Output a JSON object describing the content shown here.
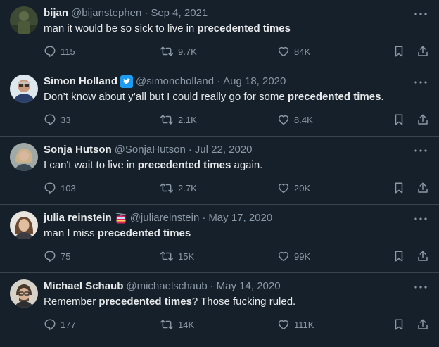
{
  "tweets": [
    {
      "name": "bijan",
      "handle": "@bijanstephen",
      "date": "Sep 4, 2021",
      "text_parts": [
        "man it would be so sick to live in ",
        "precedented times",
        ""
      ],
      "replies": "115",
      "retweets": "9.7K",
      "likes": "84K",
      "avatar_icon": "soldier-avatar"
    },
    {
      "name": "Simon Holland",
      "handle": "@simoncholland",
      "date": "Aug 18, 2020",
      "text_parts": [
        "Don’t know about y’all but I could really go for some ",
        "precedented times",
        "."
      ],
      "replies": "33",
      "retweets": "2.1K",
      "likes": "8.4K",
      "avatar_icon": "portrait-avatar",
      "badge_icon": "twitter-bird-icon"
    },
    {
      "name": "Sonja Hutson",
      "handle": "@SonjaHutson",
      "date": "Jul 22, 2020",
      "text_parts": [
        "I can't wait to live in ",
        "precedented times",
        " again."
      ],
      "replies": "103",
      "retweets": "2.7K",
      "likes": "20K",
      "avatar_icon": "portrait-avatar"
    },
    {
      "name": "julia reinstein",
      "handle": "@juliareinstein",
      "date": "May 17, 2020",
      "text_parts": [
        "man I miss ",
        "precedented times",
        ""
      ],
      "replies": "75",
      "retweets": "15K",
      "likes": "99K",
      "avatar_icon": "portrait-avatar",
      "badge_icon": "cable-car-icon"
    },
    {
      "name": "Michael Schaub",
      "handle": "@michaelschaub",
      "date": "May 14, 2020",
      "text_parts": [
        "Remember ",
        "precedented times",
        "? Those fucking ruled."
      ],
      "replies": "177",
      "retweets": "14K",
      "likes": "111K",
      "avatar_icon": "portrait-avatar"
    }
  ],
  "separator": "·",
  "colors": {
    "background": "#15202b",
    "text": "#e7e9ea",
    "muted": "#8b98a5",
    "border": "#38444d",
    "verified": "#1d9bf0"
  }
}
